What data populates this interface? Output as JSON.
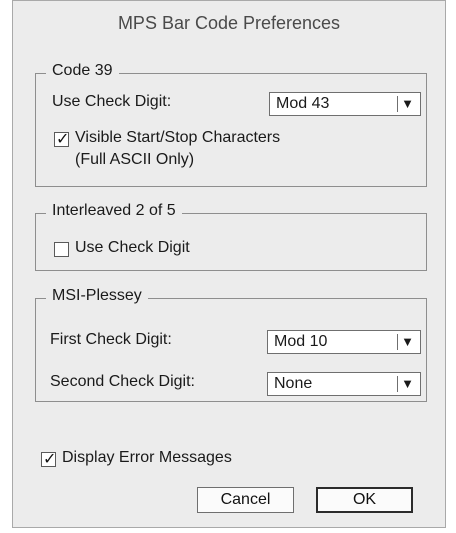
{
  "dialog": {
    "title": "MPS Bar Code Preferences"
  },
  "code39": {
    "legend": "Code 39",
    "check_digit_label": "Use Check Digit:",
    "check_digit_value": "Mod 43",
    "visible_start_stop_label": "Visible Start/Stop Characters",
    "visible_start_stop_note": "(Full ASCII Only)",
    "visible_start_stop_checked": true
  },
  "interleaved": {
    "legend": "Interleaved 2 of 5",
    "use_check_digit_label": "Use Check Digit",
    "use_check_digit_checked": false
  },
  "msi": {
    "legend": "MSI-Plessey",
    "first_label": "First Check Digit:",
    "first_value": "Mod 10",
    "second_label": "Second Check Digit:",
    "second_value": "None"
  },
  "display_errors": {
    "label": "Display Error Messages",
    "checked": true
  },
  "buttons": {
    "cancel": "Cancel",
    "ok": "OK"
  },
  "icons": {
    "dropdown": "chevron-down-icon",
    "checkmark": "checkmark-icon"
  }
}
